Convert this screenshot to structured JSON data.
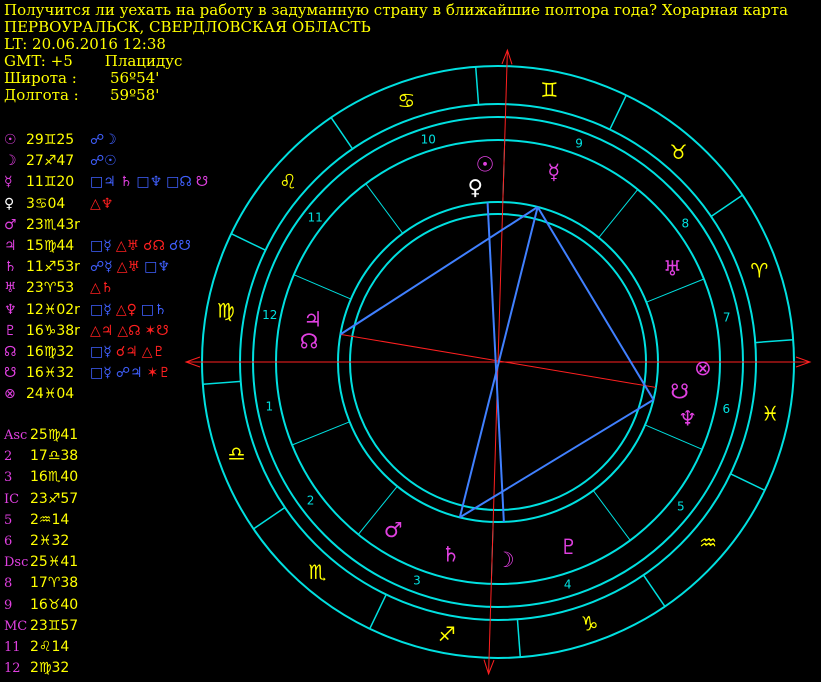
{
  "header": {
    "title": "Получится ли уехать на работу в задуманную страну в ближайшие полтора года? Хорарная карта",
    "place": "ПЕРВОУРАЛЬСК, СВЕРДЛОВСКАЯ ОБЛАСТЬ",
    "lt": "LT: 20.06.2016  12:38",
    "gmt": "GMT: +5",
    "system": "Плацидус",
    "lat_label": "Широта :",
    "lat_value": "56º54'",
    "lon_label": "Долгота :",
    "lon_value": "59º58'"
  },
  "colors": {
    "wheel": "#00e0e0",
    "text": "#ffff00",
    "magenta": "#e040e0",
    "red": "#ff2020",
    "blue": "#4080ff",
    "grid": "#00c0c0"
  },
  "planets": [
    {
      "glyph": "☉",
      "color": "#e040e0",
      "pos": "29♊25",
      "aspects": [
        {
          "t": "☍☽",
          "c": "#4060ff"
        }
      ]
    },
    {
      "glyph": "☽",
      "color": "#e040e0",
      "pos": "27♐47",
      "aspects": [
        {
          "t": "☍☉",
          "c": "#4060ff"
        }
      ]
    },
    {
      "glyph": "☿",
      "color": "#e040e0",
      "pos": "11♊20",
      "aspects": [
        {
          "t": "□♃",
          "c": "#4060ff"
        },
        {
          "t": "♄",
          "c": "#e040e0"
        },
        {
          "t": "□♆",
          "c": "#4060ff"
        },
        {
          "t": "□☊",
          "c": "#4060ff"
        },
        {
          "t": "☋",
          "c": "#e040e0"
        }
      ]
    },
    {
      "glyph": "♀",
      "color": "#ffffff",
      "pos": "3♋04",
      "aspects": [
        {
          "t": "△♆",
          "c": "#ff2020"
        }
      ]
    },
    {
      "glyph": "♂",
      "color": "#e040e0",
      "pos": "23♏43r",
      "aspects": []
    },
    {
      "glyph": "♃",
      "color": "#e040e0",
      "pos": "15♍44",
      "aspects": [
        {
          "t": "□☿",
          "c": "#4060ff"
        },
        {
          "t": "△♅",
          "c": "#ff2020"
        },
        {
          "t": "☌☊",
          "c": "#ff2020"
        },
        {
          "t": "☌☋",
          "c": "#4060ff"
        }
      ]
    },
    {
      "glyph": "♄",
      "color": "#e040e0",
      "pos": "11♐53r",
      "aspects": [
        {
          "t": "☍☿",
          "c": "#4060ff"
        },
        {
          "t": "△♅",
          "c": "#ff2020"
        },
        {
          "t": "□♆",
          "c": "#4060ff"
        }
      ]
    },
    {
      "glyph": "♅",
      "color": "#e040e0",
      "pos": "23♈53",
      "aspects": [
        {
          "t": "△♄",
          "c": "#ff2020"
        }
      ]
    },
    {
      "glyph": "♆",
      "color": "#e040e0",
      "pos": "12♓02r",
      "aspects": [
        {
          "t": "□☿",
          "c": "#4060ff"
        },
        {
          "t": "△♀",
          "c": "#ff2020"
        },
        {
          "t": "□♄",
          "c": "#4060ff"
        }
      ]
    },
    {
      "glyph": "♇",
      "color": "#e040e0",
      "pos": "16♑38r",
      "aspects": [
        {
          "t": "△♃",
          "c": "#ff2020"
        },
        {
          "t": "△☊",
          "c": "#ff2020"
        },
        {
          "t": "✶☋",
          "c": "#ff2020"
        }
      ]
    },
    {
      "glyph": "☊",
      "color": "#e040e0",
      "pos": "16♍32",
      "aspects": [
        {
          "t": "□☿",
          "c": "#4060ff"
        },
        {
          "t": "☌♃",
          "c": "#ff2020"
        },
        {
          "t": "△♇",
          "c": "#ff2020"
        }
      ]
    },
    {
      "glyph": "☋",
      "color": "#e040e0",
      "pos": "16♓32",
      "aspects": [
        {
          "t": "□☿",
          "c": "#4060ff"
        },
        {
          "t": "☍♃",
          "c": "#4060ff"
        },
        {
          "t": "✶♇",
          "c": "#ff2020"
        }
      ]
    },
    {
      "glyph": "⊗",
      "color": "#e040e0",
      "pos": "24♓04",
      "aspects": []
    }
  ],
  "cusps": [
    {
      "label": "Asc",
      "pos": "25♍41"
    },
    {
      "label": "2",
      "pos": "17♎38"
    },
    {
      "label": "3",
      "pos": "16♏40"
    },
    {
      "label": "IC",
      "pos": "23♐57"
    },
    {
      "label": "5",
      "pos": "2♒14"
    },
    {
      "label": "6",
      "pos": "2♓32"
    },
    {
      "label": "Dsc",
      "pos": "25♓41"
    },
    {
      "label": "8",
      "pos": "17♈38"
    },
    {
      "label": "9",
      "pos": "16♉40"
    },
    {
      "label": "MC",
      "pos": "23♊57"
    },
    {
      "label": "11",
      "pos": "2♌14"
    },
    {
      "label": "12",
      "pos": "2♍32"
    }
  ],
  "chart_data": {
    "type": "table",
    "houses": [
      {
        "n": "1",
        "lon": 175.68
      },
      {
        "n": "2",
        "lon": 197.63
      },
      {
        "n": "3",
        "lon": 226.67
      },
      {
        "n": "4",
        "lon": 263.95
      },
      {
        "n": "5",
        "lon": 302.23
      },
      {
        "n": "6",
        "lon": 332.53
      },
      {
        "n": "7",
        "lon": 355.68
      },
      {
        "n": "8",
        "lon": 17.63
      },
      {
        "n": "9",
        "lon": 46.67
      },
      {
        "n": "10",
        "lon": 83.95
      },
      {
        "n": "11",
        "lon": 122.23
      },
      {
        "n": "12",
        "lon": 152.53
      }
    ],
    "signs": [
      {
        "g": "♈",
        "lon": 15,
        "c": "#ffff00"
      },
      {
        "g": "♉",
        "lon": 45,
        "c": "#ffff00"
      },
      {
        "g": "♊",
        "lon": 75,
        "c": "#ffff00"
      },
      {
        "g": "♋",
        "lon": 105,
        "c": "#ffff00"
      },
      {
        "g": "♌",
        "lon": 135,
        "c": "#ffff00"
      },
      {
        "g": "♍",
        "lon": 165,
        "c": "#ffff00"
      },
      {
        "g": "♎",
        "lon": 195,
        "c": "#ffff00"
      },
      {
        "g": "♏",
        "lon": 225,
        "c": "#ffff00"
      },
      {
        "g": "♐",
        "lon": 255,
        "c": "#ffff00"
      },
      {
        "g": "♑",
        "lon": 285,
        "c": "#ffff00"
      },
      {
        "g": "♒",
        "lon": 315,
        "c": "#ffff00"
      },
      {
        "g": "♓",
        "lon": 345,
        "c": "#ffff00"
      }
    ],
    "bodies": [
      {
        "g": "☉",
        "lon": 89.42,
        "c": "#e040e0"
      },
      {
        "g": "♀",
        "lon": 93.07,
        "c": "#ffffff"
      },
      {
        "g": "☿",
        "lon": 71.33,
        "c": "#e040e0"
      },
      {
        "g": "☽",
        "lon": 267.78,
        "c": "#e040e0"
      },
      {
        "g": "♂",
        "lon": 233.72,
        "c": "#e040e0"
      },
      {
        "g": "♃",
        "lon": 165.73,
        "c": "#e040e0"
      },
      {
        "g": "☊",
        "lon": 166.53,
        "c": "#e040e0"
      },
      {
        "g": "♄",
        "lon": 251.88,
        "c": "#e040e0"
      },
      {
        "g": "♅",
        "lon": 23.88,
        "c": "#e040e0"
      },
      {
        "g": "♆",
        "lon": 342.03,
        "c": "#e040e0"
      },
      {
        "g": "☋",
        "lon": 346.53,
        "c": "#e040e0"
      },
      {
        "g": "♇",
        "lon": 286.63,
        "c": "#e040e0"
      },
      {
        "g": "⊗",
        "lon": 354.07,
        "c": "#e040e0"
      }
    ],
    "aspect_lines": [
      {
        "a": 165.73,
        "b": 346.53,
        "c": "#ff2020"
      },
      {
        "a": 251.88,
        "b": 71.33,
        "c": "#ff2020"
      },
      {
        "a": 165.73,
        "b": 71.33,
        "c": "#4080ff"
      },
      {
        "a": 71.33,
        "b": 342.03,
        "c": "#4080ff"
      },
      {
        "a": 342.03,
        "b": 251.88,
        "c": "#4080ff"
      },
      {
        "a": 71.33,
        "b": 251.88,
        "c": "#4080ff"
      },
      {
        "a": 89.42,
        "b": 267.78,
        "c": "#4080ff"
      }
    ]
  }
}
